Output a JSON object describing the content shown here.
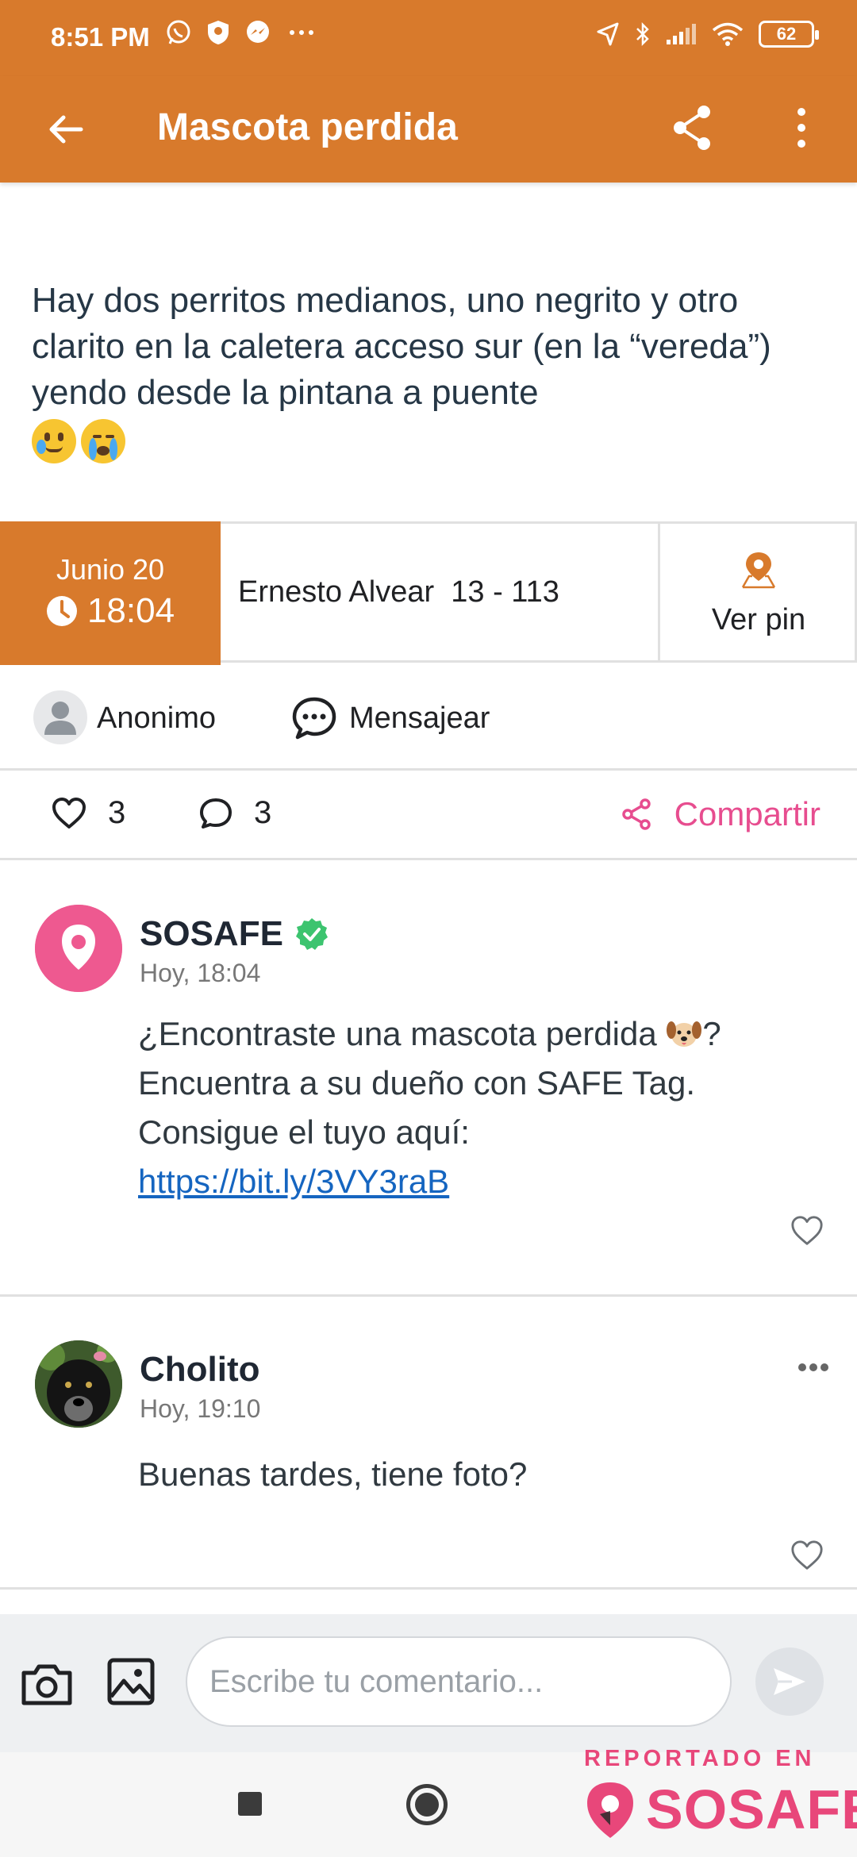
{
  "status_bar": {
    "time": "8:51 PM",
    "battery": "62"
  },
  "app_bar": {
    "title": "Mascota perdida"
  },
  "post": {
    "description_text": "Hay dos perritos medianos, uno negrito y otro clarito en la caletera acceso sur (en la “vereda”) yendo desde la pintana a puente",
    "date_day": "Junio 20",
    "date_time": "18:04",
    "address": "Ernesto Alvear  13 - 113",
    "pin_label": "Ver pin",
    "author": "Anonimo",
    "message_label": "Mensajear",
    "like_count": "3",
    "comment_count": "3",
    "share_label": "Compartir"
  },
  "comments": [
    {
      "name": "SOSAFE",
      "verified": true,
      "time": "Hoy, 18:04",
      "text_part1": "¿Encontraste una mascota perdida",
      "text_part2": "? Encuentra a su dueño con SAFE Tag. Consigue el tuyo aquí:",
      "link": "https://bit.ly/3VY3raB"
    },
    {
      "name": "Cholito",
      "time": "Hoy, 19:10",
      "text": "Buenas tardes, tiene foto?"
    }
  ],
  "comment_bar": {
    "placeholder": "Escribe tu comentario..."
  },
  "watermark": {
    "label": "REPORTADO EN",
    "brand": "SOSAFE"
  },
  "colors": {
    "accent": "#D87A2C",
    "pink": "#E74D8F",
    "link": "#1565C0",
    "verified": "#3CC46F"
  },
  "icons": [
    "back-arrow-icon",
    "share-icon",
    "more-vert-icon",
    "clock-icon",
    "map-pin-icon",
    "user-icon",
    "chat-bubble-icon",
    "heart-icon",
    "comment-icon",
    "share-nodes-icon",
    "verified-badge-icon",
    "camera-icon",
    "image-icon",
    "send-icon"
  ]
}
